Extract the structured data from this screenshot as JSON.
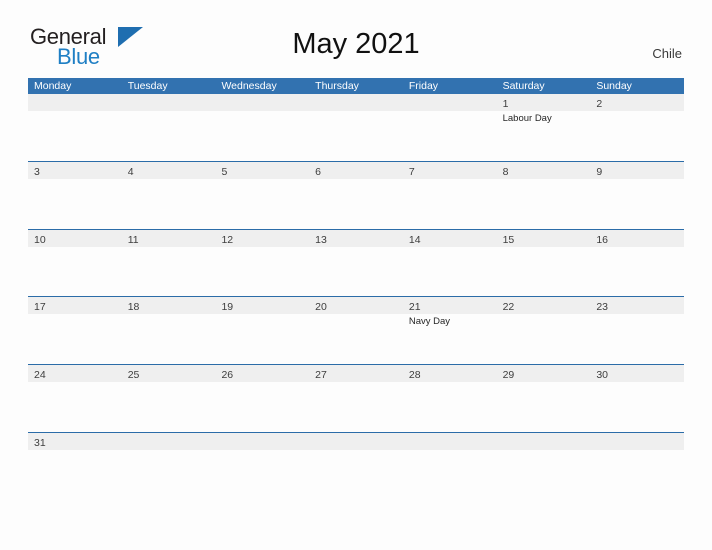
{
  "brand": {
    "name_part1": "General",
    "name_part2": "Blue",
    "flag_icon": "blue-triangle-flag-icon",
    "color_dark": "#231f20",
    "color_blue": "#1f7fc4"
  },
  "header": {
    "title": "May 2021",
    "country": "Chile"
  },
  "theme": {
    "header_blue": "#3272b0",
    "rule_blue": "#2b6ca8",
    "band_gray": "#efefef",
    "page_bg": "#fdfdfd"
  },
  "calendar": {
    "month": "May",
    "year": "2021",
    "weekday_headers": [
      "Monday",
      "Tuesday",
      "Wednesday",
      "Thursday",
      "Friday",
      "Saturday",
      "Sunday"
    ],
    "weeks": [
      {
        "days": [
          {
            "number": "",
            "events": []
          },
          {
            "number": "",
            "events": []
          },
          {
            "number": "",
            "events": []
          },
          {
            "number": "",
            "events": []
          },
          {
            "number": "",
            "events": []
          },
          {
            "number": "1",
            "events": [
              "Labour Day"
            ]
          },
          {
            "number": "2",
            "events": []
          }
        ]
      },
      {
        "days": [
          {
            "number": "3",
            "events": []
          },
          {
            "number": "4",
            "events": []
          },
          {
            "number": "5",
            "events": []
          },
          {
            "number": "6",
            "events": []
          },
          {
            "number": "7",
            "events": []
          },
          {
            "number": "8",
            "events": []
          },
          {
            "number": "9",
            "events": []
          }
        ]
      },
      {
        "days": [
          {
            "number": "10",
            "events": []
          },
          {
            "number": "11",
            "events": []
          },
          {
            "number": "12",
            "events": []
          },
          {
            "number": "13",
            "events": []
          },
          {
            "number": "14",
            "events": []
          },
          {
            "number": "15",
            "events": []
          },
          {
            "number": "16",
            "events": []
          }
        ]
      },
      {
        "days": [
          {
            "number": "17",
            "events": []
          },
          {
            "number": "18",
            "events": []
          },
          {
            "number": "19",
            "events": []
          },
          {
            "number": "20",
            "events": []
          },
          {
            "number": "21",
            "events": [
              "Navy Day"
            ]
          },
          {
            "number": "22",
            "events": []
          },
          {
            "number": "23",
            "events": []
          }
        ]
      },
      {
        "days": [
          {
            "number": "24",
            "events": []
          },
          {
            "number": "25",
            "events": []
          },
          {
            "number": "26",
            "events": []
          },
          {
            "number": "27",
            "events": []
          },
          {
            "number": "28",
            "events": []
          },
          {
            "number": "29",
            "events": []
          },
          {
            "number": "30",
            "events": []
          }
        ]
      },
      {
        "days": [
          {
            "number": "31",
            "events": []
          },
          {
            "number": "",
            "events": []
          },
          {
            "number": "",
            "events": []
          },
          {
            "number": "",
            "events": []
          },
          {
            "number": "",
            "events": []
          },
          {
            "number": "",
            "events": []
          },
          {
            "number": "",
            "events": []
          }
        ]
      }
    ]
  }
}
